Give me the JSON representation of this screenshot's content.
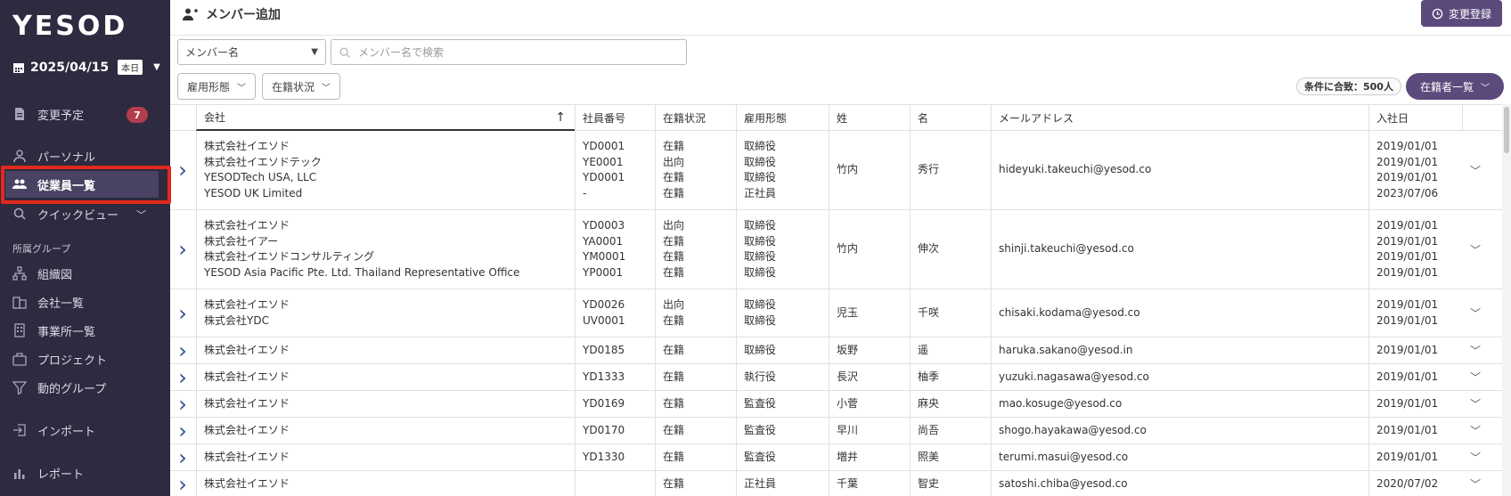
{
  "app": {
    "logo": "YESOD",
    "date": "2025/04/15",
    "today_badge": "本日"
  },
  "sidebar": {
    "items": [
      {
        "label": "変更予定",
        "icon": "document-icon",
        "badge": "7"
      },
      {
        "label": "パーソナル",
        "icon": "person-icon"
      },
      {
        "label": "従業員一覧",
        "icon": "people-icon",
        "active": true
      },
      {
        "label": "クイックビュー",
        "icon": "search-icon"
      }
    ],
    "section_label": "所属グループ",
    "group_items": [
      {
        "label": "組織図",
        "icon": "org-chart-icon"
      },
      {
        "label": "会社一覧",
        "icon": "company-icon"
      },
      {
        "label": "事業所一覧",
        "icon": "building-icon"
      },
      {
        "label": "プロジェクト",
        "icon": "briefcase-icon"
      },
      {
        "label": "動的グループ",
        "icon": "filter-icon"
      }
    ],
    "bottom_items": [
      {
        "label": "インポート",
        "icon": "import-icon"
      },
      {
        "label": "レポート",
        "icon": "chart-icon"
      }
    ]
  },
  "header": {
    "title": "メンバー追加",
    "change_register_label": "変更登録"
  },
  "search": {
    "select_value": "メンバー名",
    "placeholder": "メンバー名で検索"
  },
  "filters": {
    "employment_type": "雇用形態",
    "status": "在籍状況",
    "match_count": "条件に合致：500人",
    "roster_label": "在籍者一覧"
  },
  "table": {
    "columns": [
      "会社",
      "社員番号",
      "在籍状況",
      "雇用形態",
      "姓",
      "名",
      "メールアドレス",
      "入社日"
    ],
    "rows": [
      {
        "companies": [
          "株式会社イエソド",
          "株式会社イエソドテック",
          "YESODTech USA, LLC",
          "YESOD UK Limited"
        ],
        "ids": [
          "YD0001",
          "YE0001",
          "YD0001",
          "-"
        ],
        "statuses": [
          "在籍",
          "出向",
          "在籍",
          "在籍"
        ],
        "types": [
          "取締役",
          "取締役",
          "取締役",
          "正社員"
        ],
        "last": "竹内",
        "first": "秀行",
        "email": "hideyuki.takeuchi@yesod.co",
        "dates": [
          "2019/01/01",
          "2019/01/01",
          "2019/01/01",
          "2023/07/06"
        ]
      },
      {
        "companies": [
          "株式会社イエソド",
          "株式会社イアー",
          "株式会社イエソドコンサルティング",
          "YESOD Asia Pacific Pte. Ltd. Thailand Representative Office"
        ],
        "ids": [
          "YD0003",
          "YA0001",
          "YM0001",
          "YP0001"
        ],
        "statuses": [
          "出向",
          "在籍",
          "在籍",
          "在籍"
        ],
        "types": [
          "取締役",
          "取締役",
          "取締役",
          "取締役"
        ],
        "last": "竹内",
        "first": "伸次",
        "email": "shinji.takeuchi@yesod.co",
        "dates": [
          "2019/01/01",
          "2019/01/01",
          "2019/01/01",
          "2019/01/01"
        ]
      },
      {
        "companies": [
          "株式会社イエソド",
          "株式会社YDC"
        ],
        "ids": [
          "YD0026",
          "UV0001"
        ],
        "statuses": [
          "出向",
          "在籍"
        ],
        "types": [
          "取締役",
          "取締役"
        ],
        "last": "児玉",
        "first": "千咲",
        "email": "chisaki.kodama@yesod.co",
        "dates": [
          "2019/01/01",
          "2019/01/01"
        ]
      },
      {
        "companies": [
          "株式会社イエソド"
        ],
        "ids": [
          "YD0185"
        ],
        "statuses": [
          "在籍"
        ],
        "types": [
          "取締役"
        ],
        "last": "坂野",
        "first": "遥",
        "email": "haruka.sakano@yesod.in",
        "dates": [
          "2019/01/01"
        ]
      },
      {
        "companies": [
          "株式会社イエソド"
        ],
        "ids": [
          "YD1333"
        ],
        "statuses": [
          "在籍"
        ],
        "types": [
          "執行役"
        ],
        "last": "長沢",
        "first": "柚季",
        "email": "yuzuki.nagasawa@yesod.co",
        "dates": [
          "2019/01/01"
        ]
      },
      {
        "companies": [
          "株式会社イエソド"
        ],
        "ids": [
          "YD0169"
        ],
        "statuses": [
          "在籍"
        ],
        "types": [
          "監査役"
        ],
        "last": "小菅",
        "first": "麻央",
        "email": "mao.kosuge@yesod.co",
        "dates": [
          "2019/01/01"
        ]
      },
      {
        "companies": [
          "株式会社イエソド"
        ],
        "ids": [
          "YD0170"
        ],
        "statuses": [
          "在籍"
        ],
        "types": [
          "監査役"
        ],
        "last": "早川",
        "first": "尚吾",
        "email": "shogo.hayakawa@yesod.co",
        "dates": [
          "2019/01/01"
        ]
      },
      {
        "companies": [
          "株式会社イエソド"
        ],
        "ids": [
          "YD1330"
        ],
        "statuses": [
          "在籍"
        ],
        "types": [
          "監査役"
        ],
        "last": "増井",
        "first": "照美",
        "email": "terumi.masui@yesod.co",
        "dates": [
          "2019/01/01"
        ]
      },
      {
        "companies": [
          "株式会社イエソド"
        ],
        "ids": [
          ""
        ],
        "statuses": [
          "在籍"
        ],
        "types": [
          "正社員"
        ],
        "last": "千葉",
        "first": "智史",
        "email": "satoshi.chiba@yesod.co",
        "dates": [
          "2020/07/02"
        ]
      }
    ]
  }
}
